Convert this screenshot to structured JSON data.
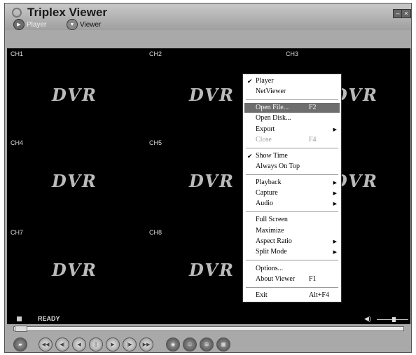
{
  "window": {
    "title": "Triplex Viewer",
    "minimize": "–",
    "close": "×"
  },
  "modes": [
    {
      "label": "Player"
    },
    {
      "label": "Viewer"
    }
  ],
  "channels": [
    {
      "label": "CH1"
    },
    {
      "label": "CH2"
    },
    {
      "label": "CH3"
    },
    {
      "label": "CH4"
    },
    {
      "label": "CH5"
    },
    {
      "label": "CH7"
    },
    {
      "label": "CH8"
    }
  ],
  "logo_text": "DVR",
  "status": {
    "text": "READY"
  },
  "menu": [
    {
      "label": "Player",
      "checked": true
    },
    {
      "label": "NetViewer"
    },
    {
      "label": "Open File...",
      "shortcut": "F2",
      "highlighted": true
    },
    {
      "label": "Open Disk..."
    },
    {
      "label": "Export",
      "submenu": true
    },
    {
      "label": "Close",
      "shortcut": "F4",
      "disabled": true
    },
    {
      "label": "Show Time",
      "checked": true
    },
    {
      "label": "Always On Top"
    },
    {
      "label": "Playback",
      "submenu": true
    },
    {
      "label": "Capture",
      "submenu": true
    },
    {
      "label": "Audio",
      "submenu": true
    },
    {
      "label": "Full Screen"
    },
    {
      "label": "Maximize"
    },
    {
      "label": "Aspect Ratio",
      "submenu": true
    },
    {
      "label": "Split Mode",
      "submenu": true
    },
    {
      "label": "Options..."
    },
    {
      "label": "About Viewer",
      "shortcut": "F1"
    },
    {
      "label": "Exit",
      "shortcut": "Alt+F4"
    }
  ],
  "controls": [
    {
      "icon": "folder-icon",
      "glyph": "▰"
    },
    {
      "icon": "prev-icon",
      "glyph": "◀◀"
    },
    {
      "icon": "step-back-icon",
      "glyph": "◀|"
    },
    {
      "icon": "reverse-play-icon",
      "glyph": "◀"
    },
    {
      "icon": "pause-icon",
      "glyph": "||"
    },
    {
      "icon": "play-icon",
      "glyph": "▶"
    },
    {
      "icon": "step-forward-icon",
      "glyph": "|▶"
    },
    {
      "icon": "next-icon",
      "glyph": "▶▶"
    },
    {
      "icon": "camera-icon",
      "glyph": "◉"
    },
    {
      "icon": "single-view-icon",
      "glyph": "□"
    },
    {
      "icon": "quad-view-icon",
      "glyph": "⊞"
    },
    {
      "icon": "nine-view-icon",
      "glyph": "▦"
    }
  ],
  "colors": {
    "highlight": "#6e6e6e",
    "video_bg": "#000000",
    "frame": "#a9a9a9"
  }
}
